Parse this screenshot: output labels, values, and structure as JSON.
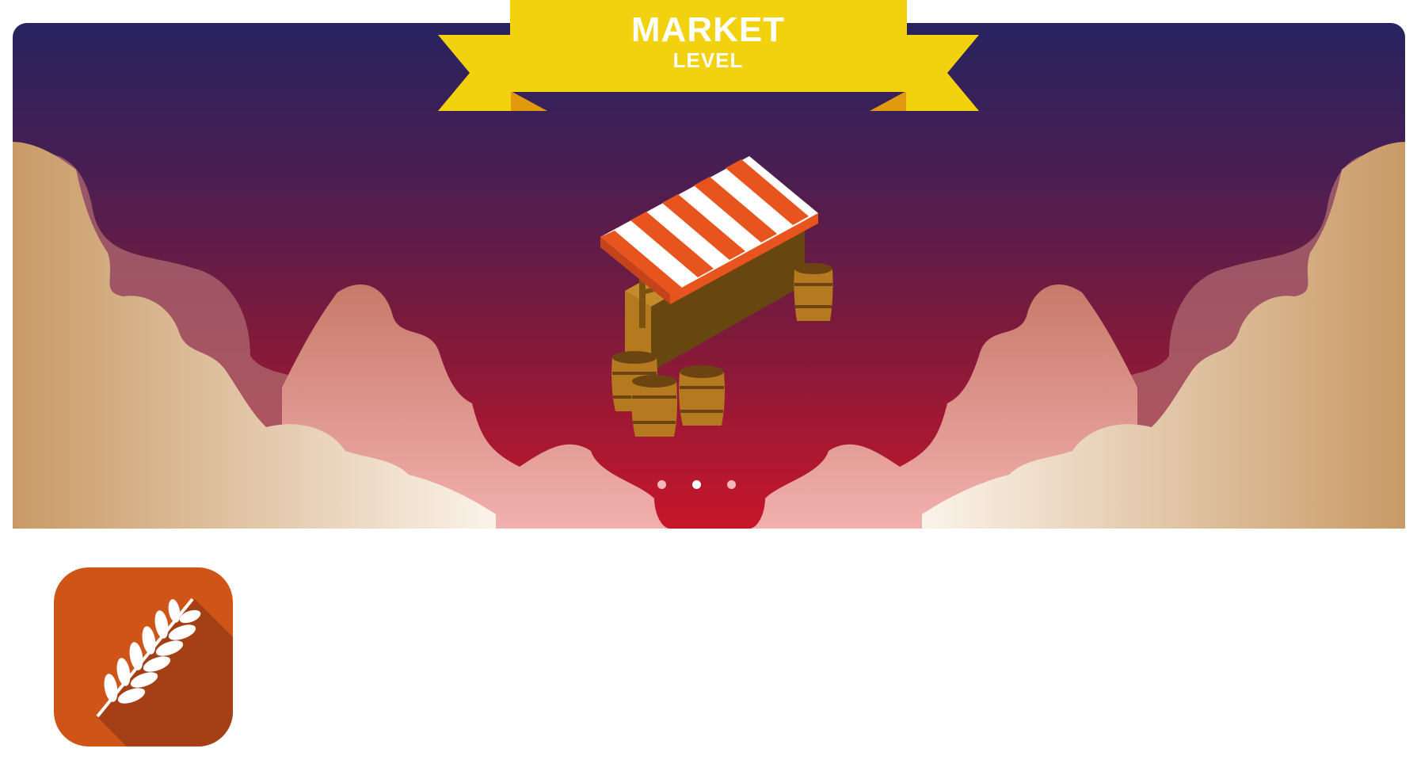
{
  "banner": {
    "title": "MARKET",
    "subtitle": "LEVEL"
  },
  "pager": {
    "count": 3,
    "active_index": 1
  },
  "app_icon": {
    "icon": "wheat-icon"
  },
  "colors": {
    "sky_top": "#27235f",
    "sky_bottom": "#c8162a",
    "ribbon": "#f2d10f",
    "ribbon_fold": "#e19a0e",
    "awning_red": "#e8541e",
    "stall_wood": "#b57a1f",
    "app_icon_bg": "#cf5418",
    "dot_active": "#ffffff",
    "dot_inactive": "#f2b8bd"
  }
}
